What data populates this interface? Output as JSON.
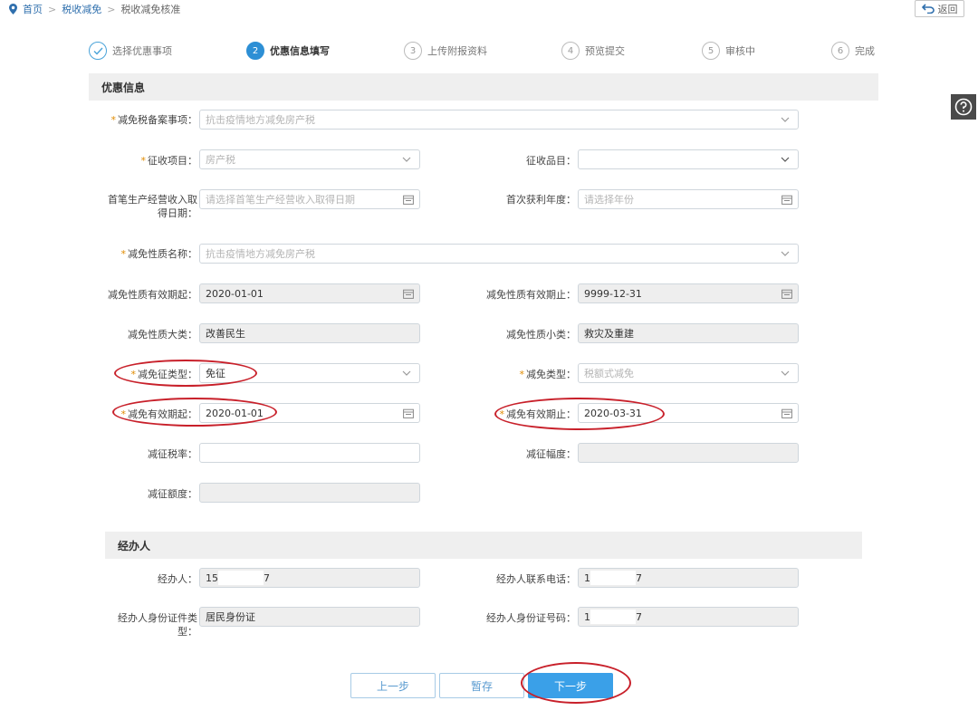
{
  "breadcrumb": {
    "home": "首页",
    "level2": "税收减免",
    "current": "税收减免核准"
  },
  "back_button": "返回",
  "steps": [
    {
      "num": "✓",
      "label": "选择优惠事项",
      "state": "done"
    },
    {
      "num": "2",
      "label": "优惠信息填写",
      "state": "active"
    },
    {
      "num": "3",
      "label": "上传附报资料",
      "state": "todo"
    },
    {
      "num": "4",
      "label": "预览提交",
      "state": "todo"
    },
    {
      "num": "5",
      "label": "审核中",
      "state": "todo"
    },
    {
      "num": "6",
      "label": "完成",
      "state": "todo"
    }
  ],
  "section1_title": "优惠信息",
  "section2_title": "经办人",
  "fields": {
    "filing_item": {
      "label": "减免税备案事项：",
      "placeholder": "抗击疫情地方减免房产税"
    },
    "levy_project": {
      "label": "征收项目：",
      "placeholder": "房产税"
    },
    "levy_item": {
      "label": "征收品目：",
      "value": ""
    },
    "first_income_date": {
      "label": "首笔生产经营收入取得日期：",
      "placeholder": "请选择首笔生产经营收入取得日期"
    },
    "first_profit_year": {
      "label": "首次获利年度：",
      "placeholder": "请选择年份"
    },
    "nature_name": {
      "label": "减免性质名称：",
      "placeholder": "抗击疫情地方减免房产税"
    },
    "nature_start": {
      "label": "减免性质有效期起：",
      "value": "2020-01-01"
    },
    "nature_end": {
      "label": "减免性质有效期止：",
      "value": "9999-12-31"
    },
    "nature_major": {
      "label": "减免性质大类：",
      "value": "改善民生"
    },
    "nature_minor": {
      "label": "减免性质小类：",
      "value": "救灾及重建"
    },
    "cert_type": {
      "label": "减免征类型：",
      "value": "免征"
    },
    "relief_type": {
      "label": "减免类型：",
      "placeholder": "税额式减免"
    },
    "valid_start": {
      "label": "减免有效期起：",
      "value": "2020-01-01"
    },
    "valid_end": {
      "label": "减免有效期止：",
      "value": "2020-03-31"
    },
    "tax_rate": {
      "label": "减征税率：",
      "value": ""
    },
    "range": {
      "label": "减征幅度：",
      "value": ""
    },
    "amount": {
      "label": "减征额度：",
      "value": ""
    },
    "handler": {
      "label": "经办人：",
      "value_a": "15",
      "value_b": "7"
    },
    "handler_phone": {
      "label": "经办人联系电话：",
      "value_a": "1",
      "value_b": "7"
    },
    "id_type": {
      "label": "经办人身份证件类型：",
      "value": "居民身份证"
    },
    "id_number": {
      "label": "经办人身份证号码：",
      "value_a": "1",
      "value_b": "7"
    }
  },
  "buttons": {
    "prev": "上一步",
    "save": "暂存",
    "next": "下一步"
  },
  "colors": {
    "accent": "#2d8fd5",
    "required": "#e08b00",
    "highlight": "#c8202a"
  }
}
